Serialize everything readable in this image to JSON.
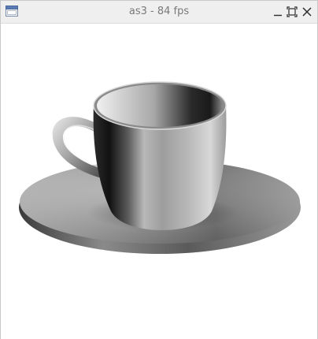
{
  "window": {
    "title": "as3 - 84 fps",
    "icons": {
      "app": "window-app-icon",
      "minimize": "minimize-icon",
      "maximize": "maximize-icon",
      "close": "close-icon"
    }
  },
  "scene": {
    "subject": "teacup-on-saucer",
    "shading": "grayscale",
    "background_color": "#ffffff"
  }
}
